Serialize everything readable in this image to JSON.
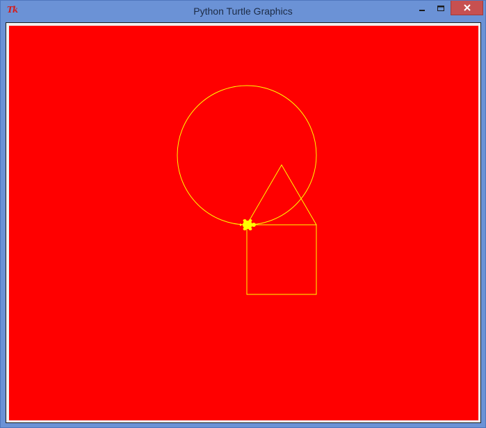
{
  "window": {
    "title": "Python Turtle Graphics",
    "app_logo_text": "Tk",
    "controls": [
      "minimize-icon",
      "maximize-icon",
      "close-icon"
    ]
  },
  "colors": {
    "titlebar": "#6b92d6",
    "canvas_background": "#ff0000",
    "pen": "#ffff00",
    "turtle": "#ffff00",
    "close_button": "#c75050"
  },
  "drawing": {
    "shapes": [
      "circle",
      "triangle",
      "square"
    ],
    "turtle_shape": "turtle"
  }
}
